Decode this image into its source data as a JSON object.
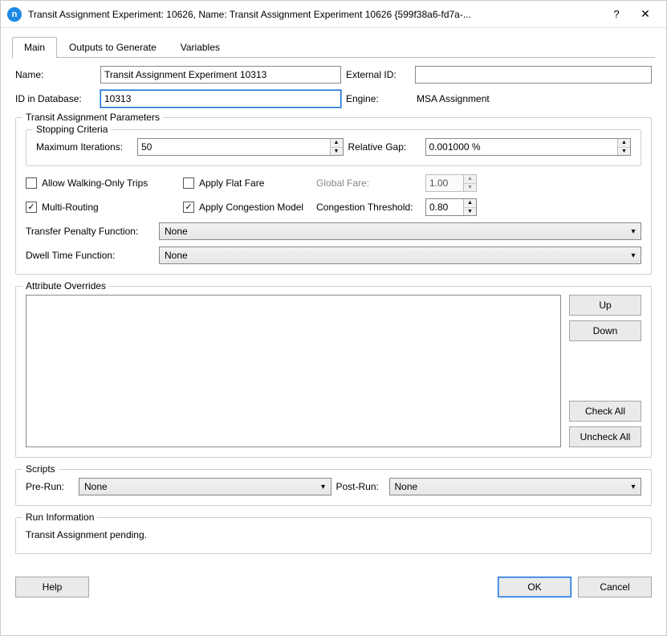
{
  "titlebar": {
    "icon_letter": "n",
    "title": "Transit Assignment Experiment: 10626, Name: Transit Assignment Experiment 10626  {599f38a6-fd7a-...",
    "help_glyph": "?",
    "close_glyph": "✕"
  },
  "tabs": {
    "main": "Main",
    "outputs": "Outputs to Generate",
    "variables": "Variables"
  },
  "form": {
    "name_label": "Name:",
    "name_value": "Transit Assignment Experiment 10313",
    "external_id_label": "External ID:",
    "external_id_value": "",
    "id_db_label": "ID in Database:",
    "id_db_value": "10313",
    "engine_label": "Engine:",
    "engine_value": "MSA Assignment"
  },
  "params": {
    "legend": "Transit Assignment Parameters",
    "stopping": {
      "legend": "Stopping Criteria",
      "max_iter_label": "Maximum Iterations:",
      "max_iter_value": "50",
      "rel_gap_label": "Relative Gap:",
      "rel_gap_value": "0.001000 %"
    },
    "allow_walking_label": "Allow Walking-Only Trips",
    "allow_walking_checked": false,
    "flat_fare_label": "Apply Flat Fare",
    "flat_fare_checked": false,
    "global_fare_label": "Global Fare:",
    "global_fare_value": "1.00",
    "multi_routing_label": "Multi-Routing",
    "multi_routing_checked": true,
    "congestion_model_label": "Apply Congestion Model",
    "congestion_model_checked": true,
    "congestion_thresh_label": "Congestion Threshold:",
    "congestion_thresh_value": "0.80",
    "transfer_penalty_label": "Transfer Penalty Function:",
    "transfer_penalty_value": "None",
    "dwell_time_label": "Dwell Time Function:",
    "dwell_time_value": "None"
  },
  "overrides": {
    "legend": "Attribute Overrides",
    "up": "Up",
    "down": "Down",
    "check_all": "Check All",
    "uncheck_all": "Uncheck All"
  },
  "scripts": {
    "legend": "Scripts",
    "pre_run_label": "Pre-Run:",
    "pre_run_value": "None",
    "post_run_label": "Post-Run:",
    "post_run_value": "None"
  },
  "runinfo": {
    "legend": "Run Information",
    "text": "Transit Assignment pending."
  },
  "buttons": {
    "help": "Help",
    "ok": "OK",
    "cancel": "Cancel"
  }
}
